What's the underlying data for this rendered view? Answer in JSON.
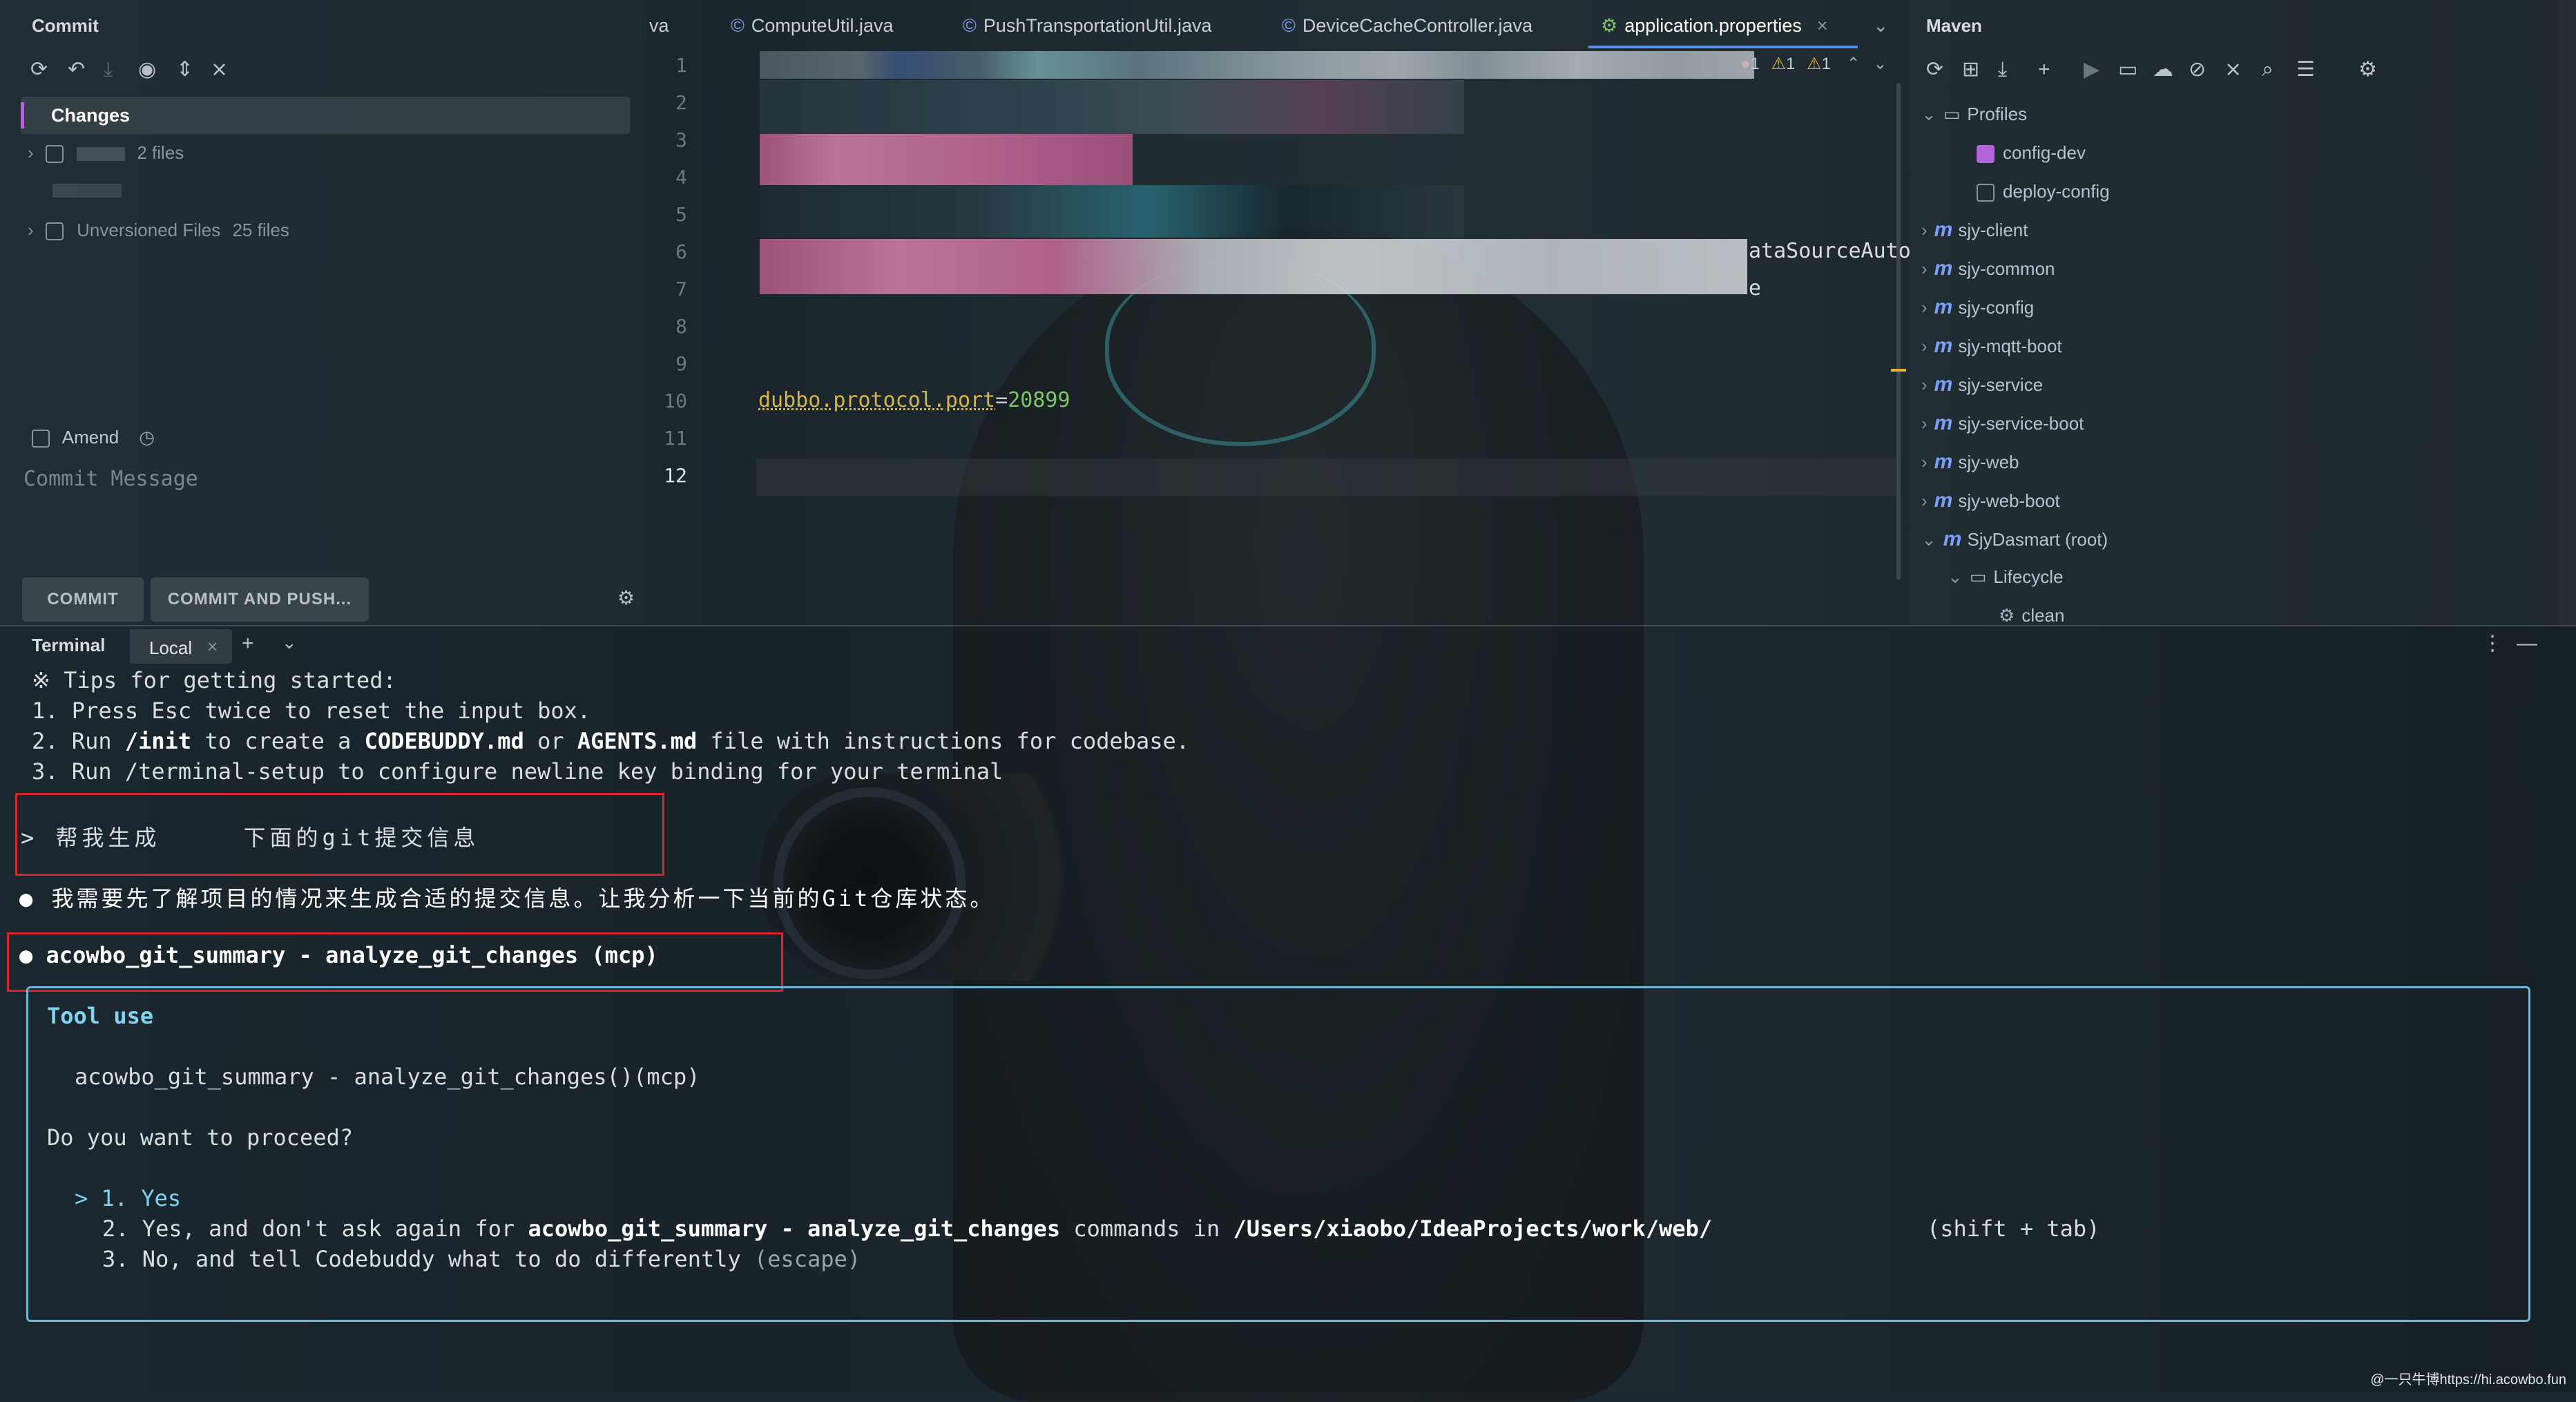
{
  "commit_panel": {
    "title": "Commit",
    "changes_label": "Changes",
    "changes_count": "2 files",
    "unversioned_label": "Unversioned Files",
    "unversioned_count": "25 files",
    "amend_label": "Amend",
    "commit_message_placeholder": "Commit Message",
    "commit_button": "COMMIT",
    "commit_push_button": "COMMIT AND PUSH..."
  },
  "editor": {
    "tabs": [
      {
        "label": "va"
      },
      {
        "label": "ComputeUtil.java"
      },
      {
        "label": "PushTransportationUtil.java"
      },
      {
        "label": "DeviceCacheController.java"
      },
      {
        "label": "application.properties"
      }
    ],
    "inspection": {
      "errors": "1",
      "warnings": "1",
      "weak_warnings": "1"
    },
    "line_numbers": [
      "1",
      "2",
      "3",
      "4",
      "5",
      "6",
      "7",
      "8",
      "9",
      "10",
      "11",
      "12"
    ],
    "visible_fragments": {
      "line6_tail": "ataSourceAuto",
      "line7_tail": "e"
    },
    "line10": {
      "key": "dubbo.protocol.port",
      "eq": "=",
      "value": "20899"
    },
    "colors": {
      "key": "#d6b54a",
      "value": "#7fc46a"
    }
  },
  "maven": {
    "title": "Maven",
    "tree": [
      {
        "label": "Profiles",
        "kind": "folder"
      },
      {
        "label": "config-dev",
        "kind": "profile",
        "checked": true
      },
      {
        "label": "deploy-config",
        "kind": "profile",
        "checked": false
      },
      {
        "label": "sjy-client",
        "kind": "module"
      },
      {
        "label": "sjy-common",
        "kind": "module"
      },
      {
        "label": "sjy-config",
        "kind": "module"
      },
      {
        "label": "sjy-mqtt-boot",
        "kind": "module"
      },
      {
        "label": "sjy-service",
        "kind": "module"
      },
      {
        "label": "sjy-service-boot",
        "kind": "module"
      },
      {
        "label": "sjy-web",
        "kind": "module"
      },
      {
        "label": "sjy-web-boot",
        "kind": "module"
      },
      {
        "label": "SjyDasmart (root)",
        "kind": "module"
      },
      {
        "label": "Lifecycle",
        "kind": "folder"
      },
      {
        "label": "clean",
        "kind": "goal"
      }
    ]
  },
  "terminal": {
    "title": "Terminal",
    "tab_label": "Local",
    "tips_header": "※ Tips for getting started:",
    "tip1": "1. Press Esc twice to reset the input box.",
    "tip2_a": "2. Run ",
    "tip2_b": "/init",
    "tip2_c": " to create a ",
    "tip2_d": "CODEBUDDY.md",
    "tip2_e": " or ",
    "tip2_f": "AGENTS.md",
    "tip2_g": " file with instructions for codebase.",
    "tip3": "3. Run /terminal-setup to configure newline key binding for your terminal",
    "prompt_a": "> 帮我生成",
    "prompt_b": "下面的git提交信息",
    "reply": "● 我需要先了解项目的情况来生成合适的提交信息。让我分析一下当前的Git仓库状态。",
    "tool_call": "● acowbo_git_summary - analyze_git_changes (mcp)",
    "tool_use_title": "Tool use",
    "tool_use_cmd": "acowbo_git_summary - analyze_git_changes()(mcp)",
    "question": "Do you want to proceed?",
    "opt1": "> 1. Yes",
    "opt2_a": "2. Yes, and don't ask again for ",
    "opt2_b": "acowbo_git_summary - analyze_git_changes",
    "opt2_c": " commands in ",
    "opt2_d": "/Users/xiaobo/IdeaProjects/work/web/",
    "opt2_e": "(shift + tab)",
    "opt3_a": "3. No, and tell Codebuddy what to do differently ",
    "opt3_b": "(escape)"
  },
  "watermark": "@一只牛博https://hi.acowbo.fun"
}
